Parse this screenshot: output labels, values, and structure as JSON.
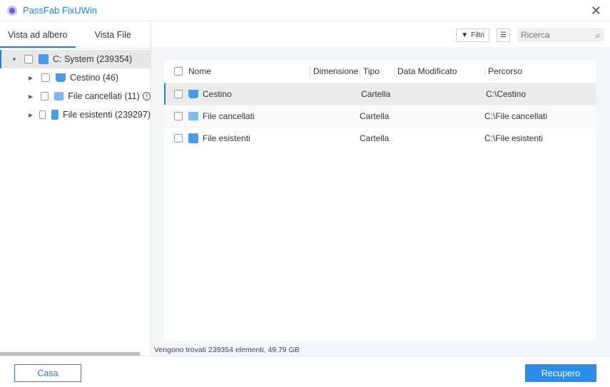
{
  "app": {
    "title": "PassFab FixUWin"
  },
  "tabs": [
    {
      "label": "Vista ad albero"
    },
    {
      "label": "Vista File"
    }
  ],
  "tree": {
    "root": "C: System (239354)",
    "children": [
      {
        "label": "Cestino (46)"
      },
      {
        "label": "File cancellati (11)"
      },
      {
        "label": "File esistenti (239297)"
      }
    ]
  },
  "toolbar": {
    "filter": "Filtri",
    "search_placeholder": "Ricerca"
  },
  "table": {
    "columns": [
      "Nome",
      "Dimensione",
      "Tipo",
      "Data Modificato",
      "Percorso"
    ],
    "rows": [
      {
        "name": "Cestino",
        "size": "",
        "type": "Cartella",
        "date": "",
        "path": "C:\\Cestino"
      },
      {
        "name": "File cancellati",
        "size": "",
        "type": "Cartella",
        "date": "",
        "path": "C:\\File cancellati"
      },
      {
        "name": "File esistenti",
        "size": "",
        "type": "Cartella",
        "date": "",
        "path": "C:\\File esistenti"
      }
    ]
  },
  "status": "Vengono trovati 239354 elementi, 49.79 GB",
  "footer": {
    "home": "Casa",
    "recover": "Recupero"
  }
}
